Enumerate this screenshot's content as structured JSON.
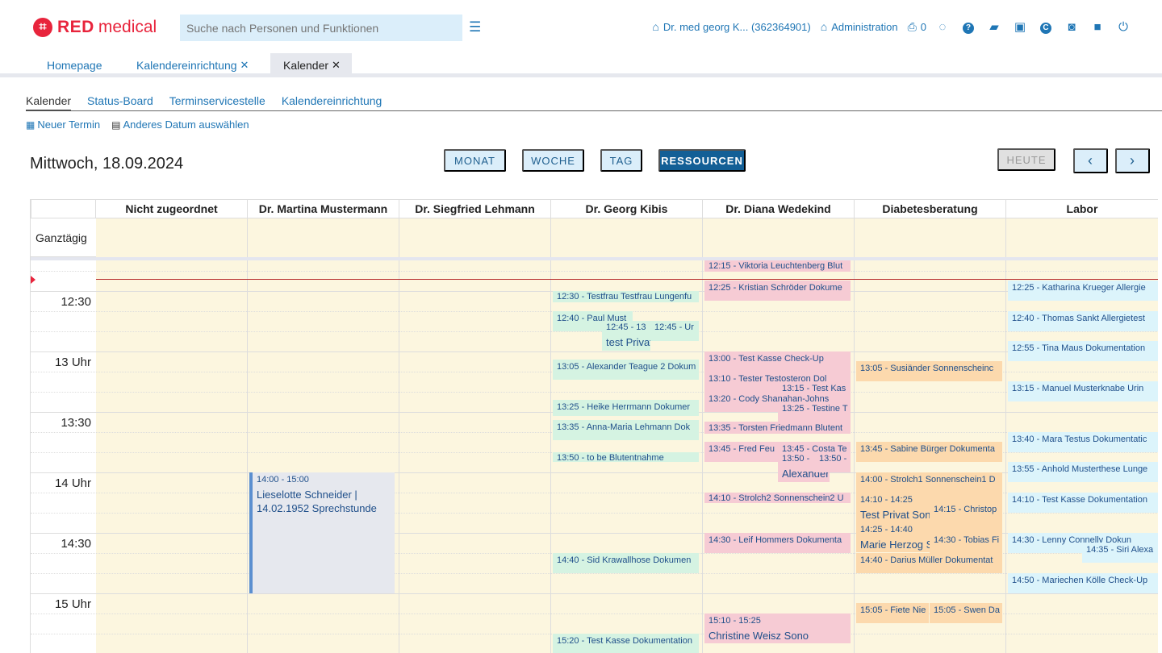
{
  "logo": {
    "badge": "⌗",
    "brand1": "RED",
    "brand2": "medical"
  },
  "search": {
    "placeholder": "Suche nach Personen und Funktionen"
  },
  "topbar": {
    "user": "Dr. med georg K... (362364901)",
    "admin": "Administration",
    "print_count": "0"
  },
  "tabs": [
    {
      "label": "Homepage"
    },
    {
      "label": "Kalendereinrichtung"
    },
    {
      "label": "Kalender"
    }
  ],
  "subnav": [
    "Kalender",
    "Status-Board",
    "Terminservicestelle",
    "Kalendereinrichtung"
  ],
  "actions": {
    "new": "Neuer Termin",
    "other_date": "Anderes Datum auswählen"
  },
  "date_title": "Mittwoch, 18.09.2024",
  "views": {
    "month": "MONAT",
    "week": "WOCHE",
    "day": "TAG",
    "resources": "RESSOURCEN",
    "today": "HEUTE"
  },
  "columns": [
    "Nicht zugeordnet",
    "Dr. Martina Mustermann",
    "Dr. Siegfried Lehmann",
    "Dr. Georg Kibis",
    "Dr. Diana Wedekind",
    "Diabetesberatung",
    "Labor"
  ],
  "allday": "Ganztägig",
  "times": [
    "12:30",
    "13 Uhr",
    "13:30",
    "14 Uhr",
    "14:30",
    "15 Uhr"
  ],
  "events": {
    "e1": "12:15 - Viktoria Leuchtenberg Blut",
    "e2": "12:25 - Kristian Schröder Dokume",
    "e3": "12:25 - Katharina Krueger Allergie",
    "e4": "12:30 - Testfrau Testfrau Lungenfu",
    "e5": "12:40 - Paul Must",
    "e6": "12:45 - 13",
    "e6b": "test Privat",
    "e7": "12:45 - Ur",
    "e8": "12:40 - Thomas Sankt Allergietest",
    "e9": "12:55 - Tina Maus Dokumentation",
    "e10": "13:00 - Test Kasse Check-Up",
    "e11": "13:05 - Alexander Teague 2 Dokum",
    "e12": "13:05 - Susiänder Sonnenscheinc",
    "e13": "13:10 - Tester Testosteron Dol",
    "e14": "13:15 - Test Kas",
    "e15": "13:15 - Manuel Musterknabe Urin",
    "e16": "13:20 - Cody Shanahan-Johns",
    "e17": "13:25 - Testine T",
    "e18": "13:25 - Heike Herrmann Dokumer",
    "e19": "13:35 - Anna-Maria Lehmann Dok",
    "e20": "13:35 - Torsten Friedmann Blutent",
    "e21": "13:40 - Mara Testus Dokumentatic",
    "e22": "13:45 - Fred Feu",
    "e23": "13:45 - Costa Te",
    "e24": "13:50 -",
    "e25": "13:50 -",
    "e25b": "Alexander",
    "e26": "13:45 - Sabine Bürger Dokumenta",
    "e27": "13:50 - to be Blutentnahme",
    "e28": "13:55 - Anhold Musterthese Lunge",
    "e29a": "14:00 - 15:00",
    "e29b": "Lieselotte Schneider | 14.02.1952 Sprechstunde",
    "e30": "14:00 - Strolch1 Sonnenschein1 D",
    "e31": "14:10 - Strolch2 Sonnenschein2 U",
    "e32a": "14:10 - 14:25",
    "e32b": "Test Privat Sono",
    "e33": "14:15 - Christop",
    "e34": "14:10 - Test Kasse Dokumentation",
    "e35a": "14:25 - 14:40",
    "e35b": "Marie Herzog Sono",
    "e36": "14:30 - Tobias Fi",
    "e37": "14:30 - Leif Hommers Dokumenta",
    "e38": "14:30 - Lenny Connelly Dokun",
    "e39": "14:35 - Siri Alexa",
    "e40": "14:40 - Sid Krawallhose Dokumen",
    "e41": "14:40 - Darius Müller Dokumentat",
    "e42": "14:50 - Mariechen Kölle Check-Up",
    "e43": "15:05 - Fiete Nie",
    "e44": "15:05 - Swen Da",
    "e45a": "15:10 - 15:25",
    "e45b": "Christine Weisz Sono",
    "e46": "15:20 - Test Kasse Dokumentation"
  },
  "colors": {
    "accent": "#1f76b5",
    "brand": "#e8243c",
    "active_view": "#135f96"
  }
}
